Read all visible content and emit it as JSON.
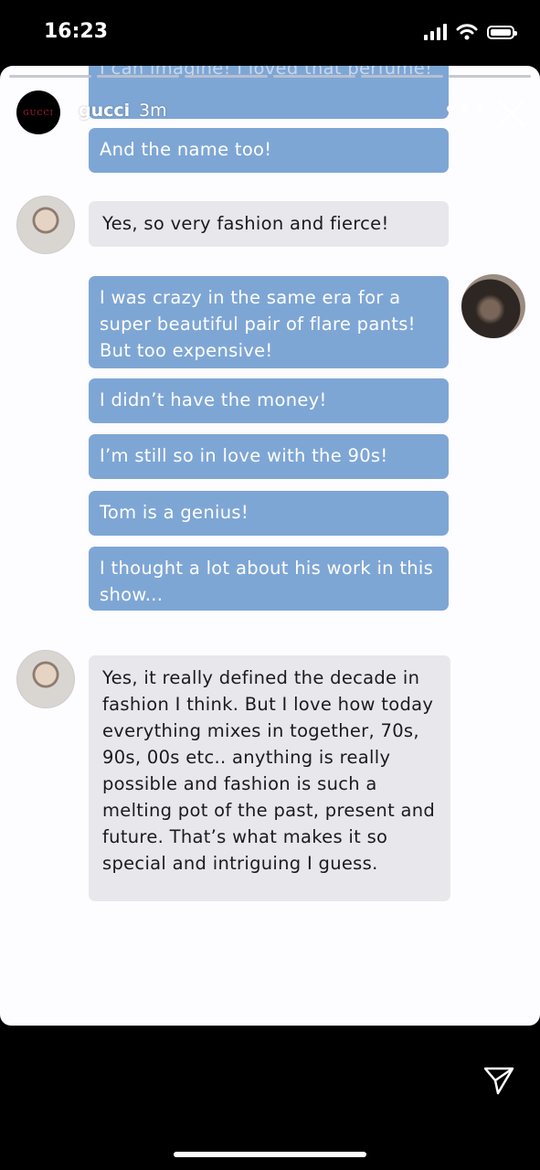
{
  "status": {
    "time": "16:23"
  },
  "header": {
    "avatar_text": "GUCCI",
    "username": "gucci",
    "time_ago": "3m",
    "more": "•••"
  },
  "messages": [
    {
      "side": "right",
      "text": "I can imagine! I loved that perfume!"
    },
    {
      "side": "right",
      "text": "And the name too!"
    },
    {
      "side": "left",
      "text": "Yes, so very fashion and fierce!"
    },
    {
      "side": "right",
      "text": "I was crazy in the same era for a super beautiful pair of flare pants! But too expensive!"
    },
    {
      "side": "right",
      "text": "I didn’t have the money!"
    },
    {
      "side": "right",
      "text": "I’m still so in love with the 90s!"
    },
    {
      "side": "right",
      "text": "Tom is a genius!"
    },
    {
      "side": "right",
      "text": "I thought a lot about his work in this show..."
    },
    {
      "side": "left",
      "text": "Yes, it really defined the decade in fashion I think. But I love how today everything mixes in together, 70s, 90s, 00s etc.. anything is really possible and fashion is such a melting pot of the past, present and future. That’s what makes it so special and intriguing I guess."
    }
  ],
  "colors": {
    "blue_bubble": "#7ea6d5",
    "gray_bubble": "#e8e7ec"
  }
}
